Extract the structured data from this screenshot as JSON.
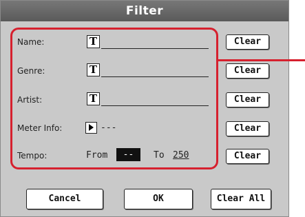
{
  "dialog": {
    "title": "Filter"
  },
  "fields": {
    "name": {
      "label": "Name:",
      "value": ""
    },
    "genre": {
      "label": "Genre:",
      "value": ""
    },
    "artist": {
      "label": "Artist:",
      "value": ""
    },
    "meter": {
      "label": "Meter Info:",
      "value": "---"
    },
    "tempo": {
      "label": "Tempo:",
      "from_label": "From",
      "from_value": "--",
      "to_label": "To",
      "to_value": "250"
    }
  },
  "buttons": {
    "clear": "Clear",
    "cancel": "Cancel",
    "ok": "OK",
    "clear_all": "Clear All"
  },
  "icons": {
    "text_edit": "T"
  },
  "colors": {
    "highlight": "#d6202e",
    "title_bg": "#666666",
    "dialog_bg": "#c9c9c9"
  }
}
